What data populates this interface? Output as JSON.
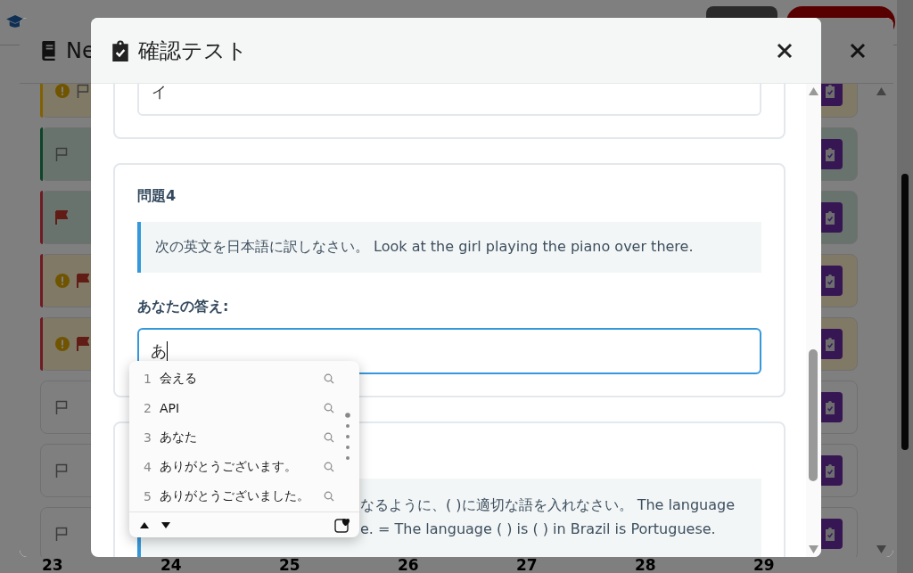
{
  "background_page": {
    "calendar_days": [
      "23",
      "24",
      "25",
      "26",
      "27",
      "28",
      "29"
    ]
  },
  "back_dialog": {
    "title": "Ne",
    "rows": [
      {
        "kind": "warning",
        "color": "#806104",
        "warning": true,
        "flagged": false
      },
      {
        "kind": "correct",
        "color": "#0d442a",
        "warning": false,
        "flagged": false
      },
      {
        "kind": "correct",
        "color": "#6e1b23",
        "warning": false,
        "flagged": true
      },
      {
        "kind": "warning",
        "color": "#6e1b23",
        "warning": true,
        "flagged": true
      },
      {
        "kind": "warning",
        "color": "#6e1b23",
        "warning": true,
        "flagged": true
      },
      {
        "kind": "plain",
        "warning": false,
        "flagged": false
      },
      {
        "kind": "plain",
        "warning": false,
        "flagged": false
      },
      {
        "kind": "plain",
        "warning": false,
        "flagged": false
      }
    ]
  },
  "quiz_dialog": {
    "title": "確認テスト",
    "previous_answer": "イ",
    "question": {
      "heading": "問題4",
      "prompt": "次の英文を日本語に訳しなさい。 Look at the girl playing the piano over there.",
      "answer_label": "あなたの答え:",
      "answer": "あ"
    },
    "next_question": {
      "prompt_lines": [
        "なるように、( )に適切な語を入れなさい。 The language",
        "e. = The language ( ) is ( ) in Brazil is Portuguese."
      ]
    }
  },
  "ime_candidates": [
    {
      "number": "1",
      "text": "会える"
    },
    {
      "number": "2",
      "text": "API"
    },
    {
      "number": "3",
      "text": "あなた"
    },
    {
      "number": "4",
      "text": "ありがとうございます。"
    },
    {
      "number": "5",
      "text": "ありがとうございました。"
    }
  ]
}
